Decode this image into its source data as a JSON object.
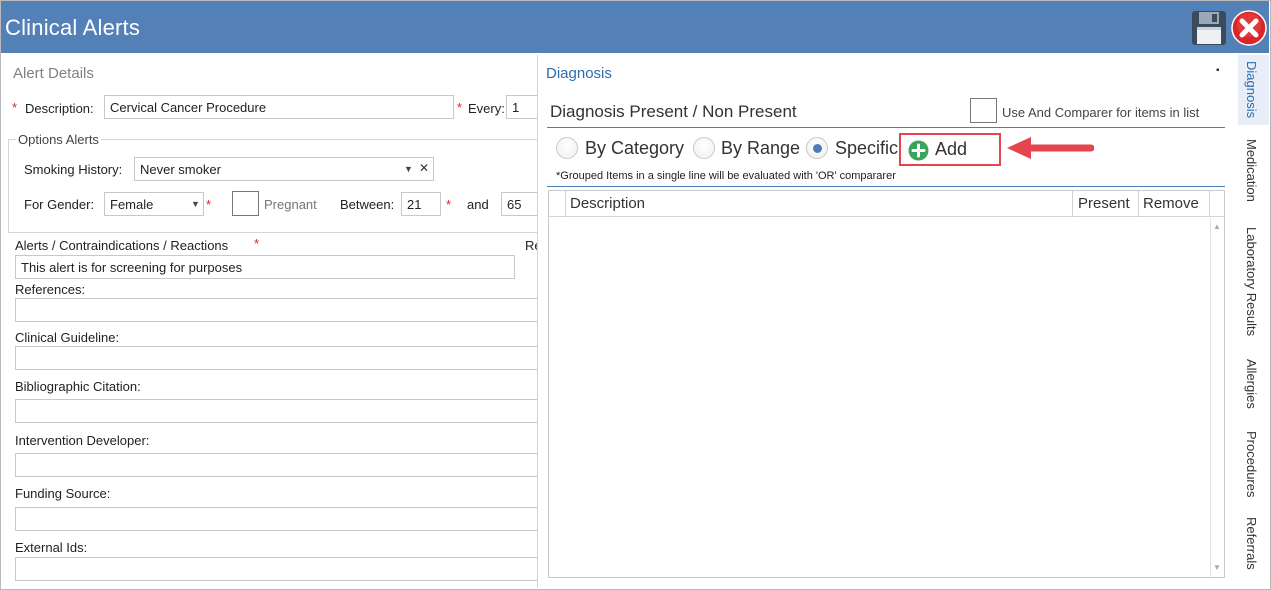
{
  "window": {
    "title": "Clinical Alerts"
  },
  "toolbar": {
    "save_icon": "floppy-disk-icon",
    "close_icon": "red-close-icon"
  },
  "alert_details": {
    "heading": "Alert Details",
    "description_label": "Description:",
    "description_value": "Cervical Cancer Procedure",
    "every_label": "Every:",
    "every_value": "1",
    "options_legend": "Options Alerts",
    "smoking_label": "Smoking History:",
    "smoking_value": "Never smoker",
    "gender_label": "For Gender:",
    "gender_value": "Female",
    "pregnant_label": "Pregnant",
    "between_label": "Between:",
    "age_from": "21",
    "and_label": "and",
    "age_to": "65",
    "contra_label": "Alerts / Contraindications / Reactions",
    "contra_value": "This alert is for screening for purposes",
    "re_cut_label": "Re",
    "references_label": "References:",
    "guideline_label": "Clinical Guideline:",
    "citation_label": "Bibliographic Citation:",
    "developer_label": "Intervention Developer:",
    "funding_label": "Funding Source:",
    "external_label": "External Ids:",
    "required_mark": "*",
    "clear_mark": "✕"
  },
  "diagnosis": {
    "heading": "Diagnosis",
    "pin_glyph": "▪",
    "present_heading": "Diagnosis Present / Non Present",
    "comparer_label": "Use And Comparer for items in list",
    "radios": [
      {
        "label": "By Category",
        "selected": false
      },
      {
        "label": "By Range",
        "selected": false
      },
      {
        "label": "Specific",
        "selected": true
      }
    ],
    "add_label": "Add",
    "note": "*Grouped Items in a single line will be evaluated with 'OR' compararer",
    "columns": [
      "Description",
      "Present",
      "Remove"
    ]
  },
  "tabs": [
    "Diagnosis",
    "Medication",
    "Laboratory Results",
    "Allergies",
    "Procedures",
    "Referrals"
  ],
  "colors": {
    "title_bar": "#5380b6",
    "accent": "#2c6cb0",
    "highlight_box": "#e5454f",
    "add_icon": "#3aa55a"
  }
}
